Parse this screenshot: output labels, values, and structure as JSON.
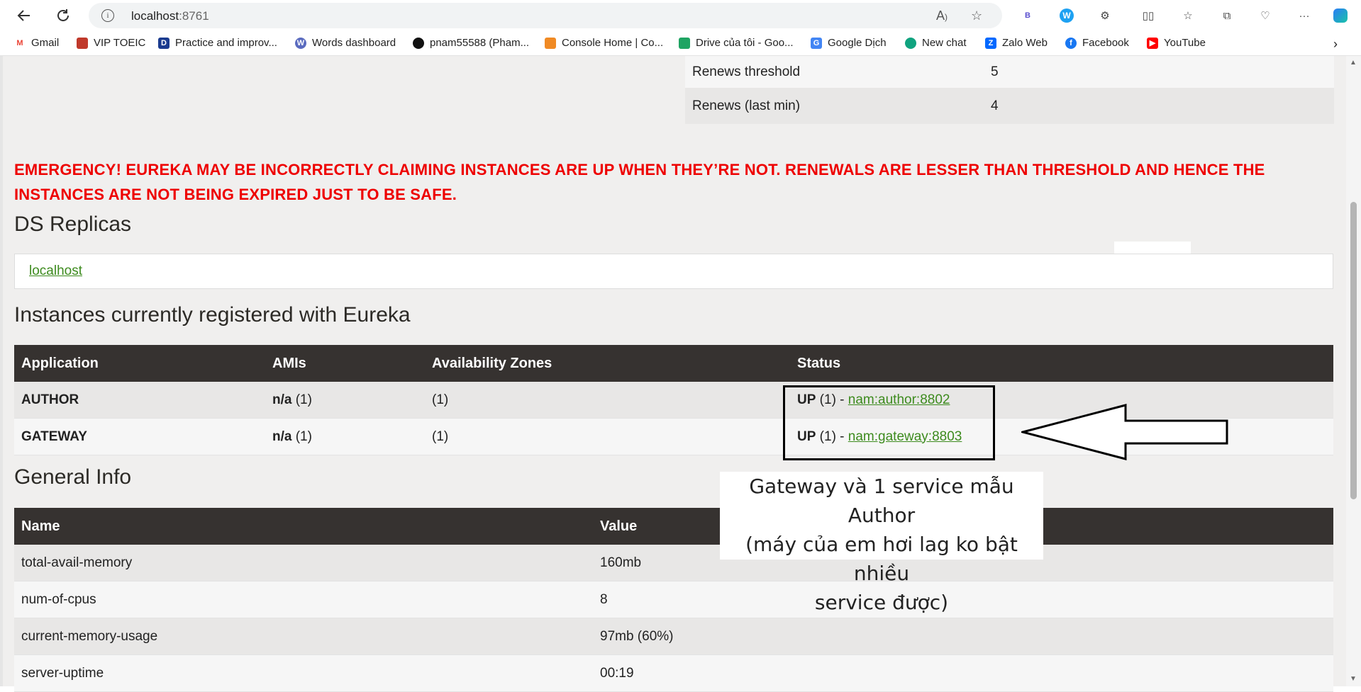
{
  "browser": {
    "url_host": "localhost",
    "url_port": ":8761",
    "bookmarks": [
      {
        "label": "Gmail",
        "icon": "gmail-icon",
        "color": "#ea4335"
      },
      {
        "label": "VIP TOEIC",
        "icon": "toeic-icon",
        "color": "#c0392b"
      },
      {
        "label": "Practice and improv...",
        "icon": "practice-icon",
        "color": "#1a3b8f"
      },
      {
        "label": "Words dashboard",
        "icon": "wordpress-icon",
        "color": "#5a6bbf"
      },
      {
        "label": "pnam55588 (Pham...",
        "icon": "github-icon",
        "color": "#111111"
      },
      {
        "label": "Console Home | Co...",
        "icon": "aws-cube-icon",
        "color": "#f08a24"
      },
      {
        "label": "Drive của tôi - Goo...",
        "icon": "google-drive-icon",
        "color": "#1fa463"
      },
      {
        "label": "Google Dịch",
        "icon": "google-translate-icon",
        "color": "#4285f4"
      },
      {
        "label": "New chat",
        "icon": "chatgpt-icon",
        "color": "#10a37f"
      },
      {
        "label": "Zalo Web",
        "icon": "zalo-icon",
        "color": "#0068ff"
      },
      {
        "label": "Facebook",
        "icon": "facebook-icon",
        "color": "#1877f2"
      },
      {
        "label": "YouTube",
        "icon": "youtube-icon",
        "color": "#ff0000"
      }
    ]
  },
  "stats": [
    {
      "key": "Renews threshold",
      "value": "5"
    },
    {
      "key": "Renews (last min)",
      "value": "4"
    }
  ],
  "emergency": "EMERGENCY! EUREKA MAY BE INCORRECTLY CLAIMING INSTANCES ARE UP WHEN THEY’RE NOT. RENEWALS ARE LESSER THAN THRESHOLD AND HENCE THE INSTANCES ARE NOT BEING EXPIRED JUST TO BE SAFE.",
  "replicas": {
    "heading": "DS Replicas",
    "link": "localhost"
  },
  "instances": {
    "heading": "Instances currently registered with Eureka",
    "columns": [
      "Application",
      "AMIs",
      "Availability Zones",
      "Status"
    ],
    "rows": [
      {
        "app": "AUTHOR",
        "ami_bold": "n/a",
        "ami_count": " (1)",
        "zones": "(1)",
        "status_bold": "UP",
        "status_text": " (1) - ",
        "status_link": "nam:author:8802"
      },
      {
        "app": "GATEWAY",
        "ami_bold": "n/a",
        "ami_count": " (1)",
        "zones": "(1)",
        "status_bold": "UP",
        "status_text": " (1) - ",
        "status_link": "nam:gateway:8803"
      }
    ]
  },
  "general": {
    "heading": "General Info",
    "columns": [
      "Name",
      "Value"
    ],
    "rows": [
      {
        "name": "total-avail-memory",
        "value": "160mb"
      },
      {
        "name": "num-of-cpus",
        "value": "8"
      },
      {
        "name": "current-memory-usage",
        "value": "97mb (60%)"
      },
      {
        "name": "server-uptime",
        "value": "00:19"
      }
    ]
  },
  "annotation": {
    "line1": "Gateway và 1 service mẫu Author",
    "line2": "(máy của em hơi lag ko bật nhiều",
    "line3": "service được)"
  },
  "colors": {
    "emergency": "#ee0000",
    "link": "#3d8b1e",
    "table_header": "#363230"
  }
}
